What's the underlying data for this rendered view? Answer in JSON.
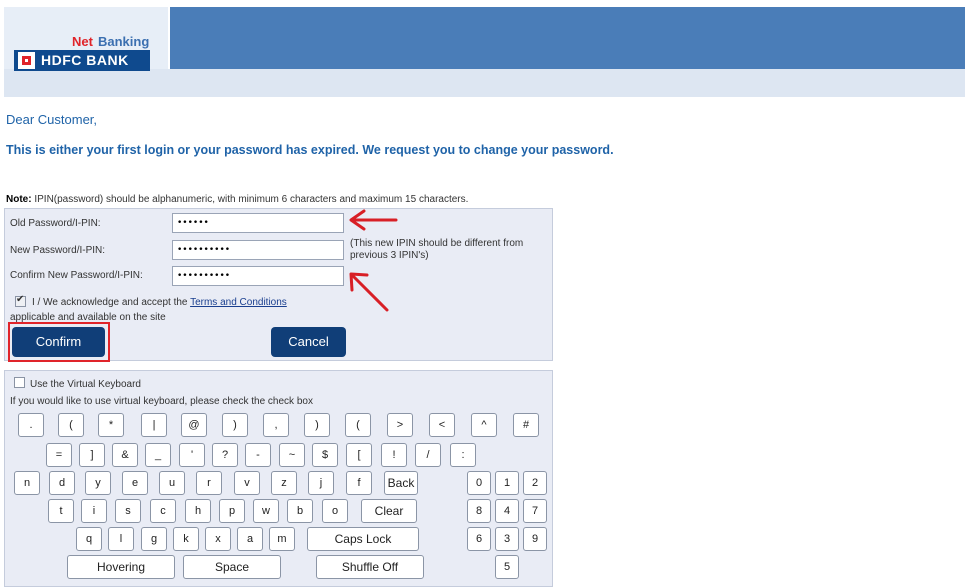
{
  "header": {
    "brand_net": "Net",
    "brand_banking": "Banking",
    "bank_name": "HDFC BANK"
  },
  "message": {
    "greeting": "Dear Customer,",
    "body": "This is either your first login or your password has expired. We request you to change your password."
  },
  "note": {
    "label": "Note:",
    "text": " IPIN(password) should be alphanumeric, with minimum 6 characters and maximum 15 characters."
  },
  "form": {
    "old_label": "Old Password/I-PIN:",
    "old_value": "••••••",
    "new_label": "New Password/I-PIN:",
    "new_value": "••••••••••",
    "confirm_label": "Confirm New Password/I-PIN:",
    "confirm_value": "••••••••••",
    "new_hint": "(This new IPIN should be different from previous 3 IPIN's)",
    "ack_prefix": "I / We acknowledge and accept the ",
    "ack_link": "Terms and Conditions",
    "ack_suffix": "applicable and available on the site",
    "confirm_button": "Confirm",
    "cancel_button": "Cancel"
  },
  "keyboard": {
    "toggle_label": "Use the Virtual Keyboard",
    "hint": "If you would like to use virtual keyboard, please check the check box",
    "row1": [
      ".",
      "(",
      "*",
      "|",
      "@",
      ")",
      ",",
      ")",
      "(",
      ">",
      "<",
      "^",
      "#"
    ],
    "row2": [
      "=",
      "]",
      "&",
      "_",
      "'",
      "?",
      "-",
      "~",
      "$",
      "[",
      "!",
      "/",
      ":"
    ],
    "row3": [
      "n",
      "d",
      "y",
      "e",
      "u",
      "r",
      "v",
      "z",
      "j",
      "f"
    ],
    "row4": [
      "t",
      "i",
      "s",
      "c",
      "h",
      "p",
      "w",
      "b",
      "o"
    ],
    "row5": [
      "q",
      "l",
      "g",
      "k",
      "x",
      "a",
      "m"
    ],
    "backspace": "Back",
    "clear": "Clear",
    "caps_lock": "Caps Lock",
    "hovering": "Hovering",
    "space": "Space",
    "shuffle_off": "Shuffle Off",
    "numpad": [
      "0",
      "1",
      "2",
      "8",
      "4",
      "7",
      "6",
      "3",
      "9",
      "5"
    ]
  },
  "colors": {
    "header_blue": "#4a7db8",
    "brand_red": "#e0242a",
    "button_navy": "#103e78",
    "text_blue": "#1f63a8"
  }
}
